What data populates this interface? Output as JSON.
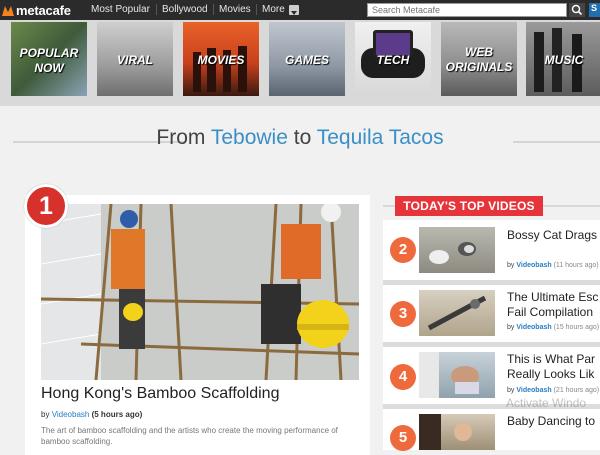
{
  "topbar": {
    "logo_text": "metacafe",
    "nav": [
      "Most Popular",
      "Bollywood",
      "Movies",
      "More"
    ],
    "search_placeholder": "Search Metacafe",
    "signin_label": "S"
  },
  "categories": [
    {
      "label": "POPULAR NOW"
    },
    {
      "label": "VIRAL"
    },
    {
      "label": "MOVIES"
    },
    {
      "label": "GAMES"
    },
    {
      "label": "TECH"
    },
    {
      "label": "WEB ORIGINALS"
    },
    {
      "label": "MUSIC"
    }
  ],
  "headline": {
    "prefix": "From",
    "from": "Tebowie",
    "middle": "to",
    "to": "Tequila Tacos"
  },
  "featured": {
    "rank": "1",
    "title": "Hong Kong's Bamboo Scaffolding",
    "by_label": "by",
    "author": "Videobash",
    "age": "(5 hours ago)",
    "description": "The art of bamboo scaffolding and the artists who create the moving performance of bamboo scaffolding."
  },
  "top_videos": {
    "label": "TODAY'S TOP VIDEOS",
    "items": [
      {
        "rank": "2",
        "title_lines": [
          "Bossy Cat Drags"
        ],
        "by": "by",
        "author": "Videobash",
        "age": "(11 hours ago)"
      },
      {
        "rank": "3",
        "title_lines": [
          "The Ultimate Esc",
          "Fail Compilation"
        ],
        "by": "by",
        "author": "Videobash",
        "age": "(15 hours ago)"
      },
      {
        "rank": "4",
        "title_lines": [
          "This is What Par",
          "Really Looks Lik"
        ],
        "by": "by",
        "author": "Videobash",
        "age": "(21 hours ago)"
      },
      {
        "rank": "5",
        "title_lines": [
          "Baby Dancing to"
        ],
        "by": "",
        "author": "",
        "age": ""
      }
    ]
  },
  "watermark": "Activate Windo",
  "colors": {
    "accent_blue": "#3a8fc7",
    "badge_red": "#d6312b",
    "rank_orange": "#ee6a3c",
    "label_red": "#e5353b"
  }
}
